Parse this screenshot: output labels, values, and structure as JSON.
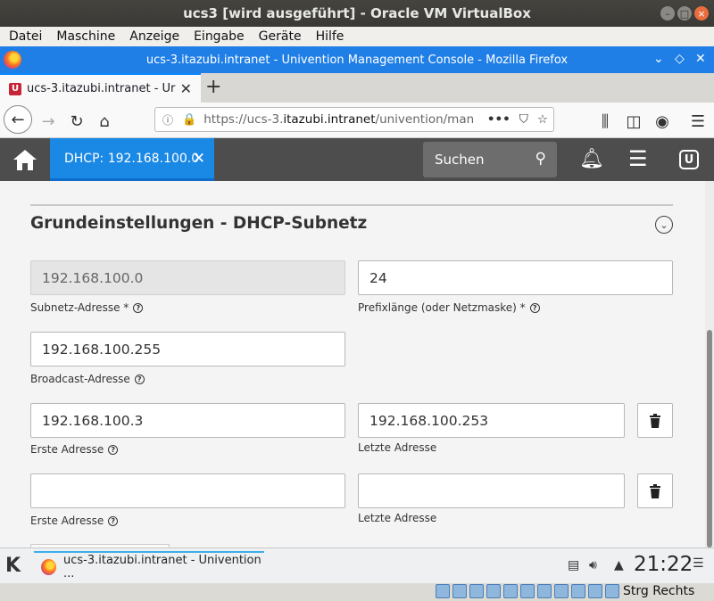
{
  "vbox": {
    "title": "ucs3 [wird ausgeführt] - Oracle VM VirtualBox",
    "menu": [
      "Datei",
      "Maschine",
      "Anzeige",
      "Eingabe",
      "Geräte",
      "Hilfe"
    ],
    "host_key": "Strg Rechts"
  },
  "firefox": {
    "window_title": "ucs-3.itazubi.intranet - Univention Management Console - Mozilla Firefox",
    "tab_title": "ucs-3.itazubi.intranet - Ur",
    "url_prefix": "https://ucs-3.",
    "url_host": "itazubi.intranet",
    "url_path": "/univention/man"
  },
  "umc": {
    "active_tab": "DHCP: 192.168.100.0",
    "search_placeholder": "Suchen"
  },
  "section": {
    "title": "Grundeinstellungen - DHCP-Subnetz"
  },
  "form": {
    "subnet_value": "192.168.100.0",
    "subnet_label": "Subnetz-Adresse *",
    "prefix_value": "24",
    "prefix_label": "Prefixlänge (oder Netzmaske) *",
    "broadcast_value": "192.168.100.255",
    "broadcast_label": "Broadcast-Adresse",
    "ranges": [
      {
        "first": "192.168.100.3",
        "last": "192.168.100.253",
        "first_label": "Erste Adresse",
        "last_label": "Letzte Adresse"
      },
      {
        "first": "",
        "last": "",
        "first_label": "Erste Adresse",
        "last_label": "Letzte Adresse"
      }
    ]
  },
  "taskbar": {
    "task_title": "ucs-3.itazubi.intranet - Univention ...",
    "clock": "21:22"
  }
}
